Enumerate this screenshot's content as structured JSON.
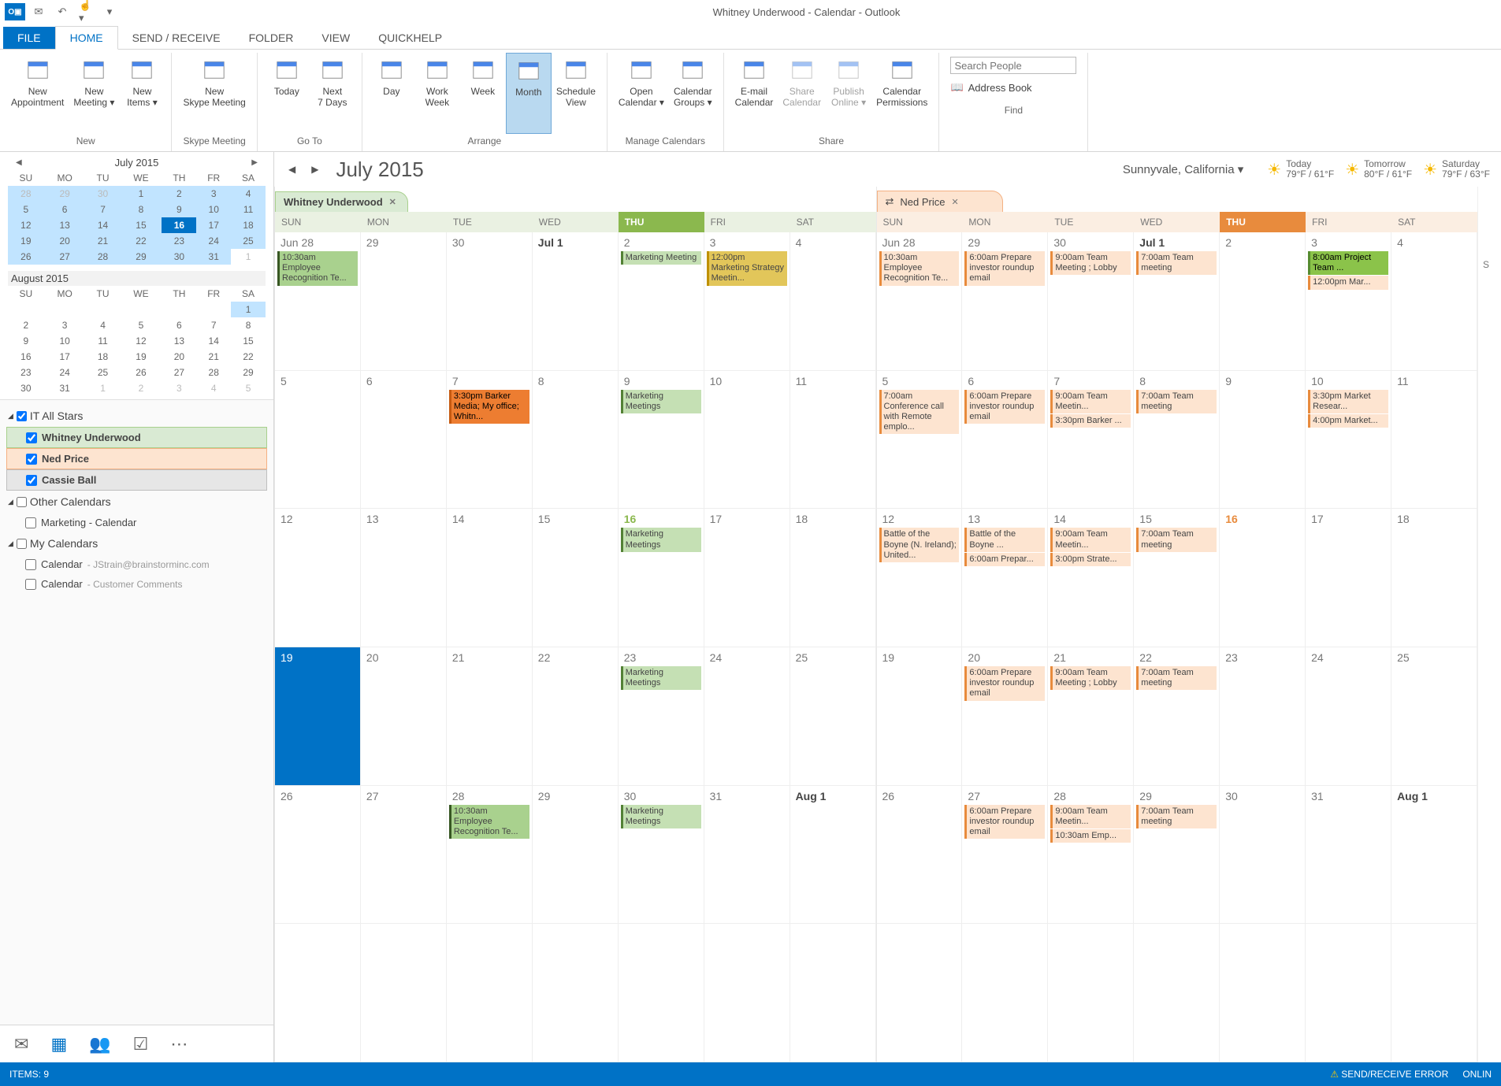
{
  "titlebar": {
    "title": "Whitney Underwood - Calendar - Outlook"
  },
  "tabs": [
    "FILE",
    "HOME",
    "SEND / RECEIVE",
    "FOLDER",
    "VIEW",
    "QUICKHELP"
  ],
  "ribbon": {
    "groups": {
      "new": {
        "label": "New",
        "btns": [
          "New Appointment",
          "New Meeting ▾",
          "New Items ▾"
        ]
      },
      "skype": {
        "label": "Skype Meeting",
        "btns": [
          "New Skype Meeting"
        ]
      },
      "goto": {
        "label": "Go To",
        "btns": [
          "Today",
          "Next 7 Days"
        ]
      },
      "arrange": {
        "label": "Arrange",
        "btns": [
          "Day",
          "Work Week",
          "Week",
          "Month",
          "Schedule View"
        ]
      },
      "manage": {
        "label": "Manage Calendars",
        "btns": [
          "Open Calendar ▾",
          "Calendar Groups ▾"
        ]
      },
      "share": {
        "label": "Share",
        "btns": [
          "E-mail Calendar",
          "Share Calendar",
          "Publish Online ▾",
          "Calendar Permissions"
        ]
      },
      "find": {
        "label": "Find",
        "search_placeholder": "Search People",
        "ab": "Address Book"
      }
    }
  },
  "minicals": [
    {
      "month": "July 2015",
      "dows": [
        "SU",
        "MO",
        "TU",
        "WE",
        "TH",
        "FR",
        "SA"
      ],
      "rows": [
        [
          {
            "d": 28,
            "dim": true,
            "hl": true
          },
          {
            "d": 29,
            "dim": true,
            "hl": true
          },
          {
            "d": 30,
            "dim": true,
            "hl": true
          },
          {
            "d": 1,
            "hl": true
          },
          {
            "d": 2,
            "hl": true
          },
          {
            "d": 3,
            "hl": true
          },
          {
            "d": 4,
            "hl": true
          }
        ],
        [
          {
            "d": 5,
            "hl": true
          },
          {
            "d": 6,
            "hl": true
          },
          {
            "d": 7,
            "hl": true
          },
          {
            "d": 8,
            "hl": true
          },
          {
            "d": 9,
            "hl": true
          },
          {
            "d": 10,
            "hl": true
          },
          {
            "d": 11,
            "hl": true
          }
        ],
        [
          {
            "d": 12,
            "hl": true
          },
          {
            "d": 13,
            "hl": true
          },
          {
            "d": 14,
            "hl": true
          },
          {
            "d": 15,
            "hl": true
          },
          {
            "d": 16,
            "today": true
          },
          {
            "d": 17,
            "hl": true
          },
          {
            "d": 18,
            "hl": true
          }
        ],
        [
          {
            "d": 19,
            "hl": true
          },
          {
            "d": 20,
            "hl": true
          },
          {
            "d": 21,
            "hl": true
          },
          {
            "d": 22,
            "hl": true
          },
          {
            "d": 23,
            "hl": true
          },
          {
            "d": 24,
            "hl": true
          },
          {
            "d": 25,
            "hl": true
          }
        ],
        [
          {
            "d": 26,
            "hl": true
          },
          {
            "d": 27,
            "hl": true
          },
          {
            "d": 28,
            "hl": true
          },
          {
            "d": 29,
            "hl": true
          },
          {
            "d": 30,
            "hl": true
          },
          {
            "d": 31,
            "hl": true
          },
          {
            "d": 1,
            "dim": true
          }
        ]
      ]
    },
    {
      "month": "August 2015",
      "dows": [
        "SU",
        "MO",
        "TU",
        "WE",
        "TH",
        "FR",
        "SA"
      ],
      "rows": [
        [
          {
            "d": ""
          },
          {
            "d": ""
          },
          {
            "d": ""
          },
          {
            "d": ""
          },
          {
            "d": ""
          },
          {
            "d": ""
          },
          {
            "d": 1,
            "hl": true
          }
        ],
        [
          {
            "d": 2
          },
          {
            "d": 3
          },
          {
            "d": 4
          },
          {
            "d": 5
          },
          {
            "d": 6
          },
          {
            "d": 7
          },
          {
            "d": 8
          }
        ],
        [
          {
            "d": 9
          },
          {
            "d": 10
          },
          {
            "d": 11
          },
          {
            "d": 12
          },
          {
            "d": 13
          },
          {
            "d": 14
          },
          {
            "d": 15
          }
        ],
        [
          {
            "d": 16
          },
          {
            "d": 17
          },
          {
            "d": 18
          },
          {
            "d": 19
          },
          {
            "d": 20
          },
          {
            "d": 21
          },
          {
            "d": 22
          }
        ],
        [
          {
            "d": 23
          },
          {
            "d": 24
          },
          {
            "d": 25
          },
          {
            "d": 26
          },
          {
            "d": 27
          },
          {
            "d": 28
          },
          {
            "d": 29
          }
        ],
        [
          {
            "d": 30
          },
          {
            "d": 31
          },
          {
            "d": 1,
            "dim": true
          },
          {
            "d": 2,
            "dim": true
          },
          {
            "d": 3,
            "dim": true
          },
          {
            "d": 4,
            "dim": true
          },
          {
            "d": 5,
            "dim": true
          }
        ]
      ]
    }
  ],
  "calgroups": [
    {
      "name": "IT All Stars",
      "checked": true,
      "items": [
        {
          "name": "Whitney Underwood",
          "checked": true,
          "cls": "sel-w"
        },
        {
          "name": "Ned Price",
          "checked": true,
          "cls": "sel-n"
        },
        {
          "name": "Cassie Ball",
          "checked": true,
          "cls": "sel-c"
        }
      ]
    },
    {
      "name": "Other Calendars",
      "checked": false,
      "items": [
        {
          "name": "Marketing - Calendar",
          "checked": false
        }
      ]
    },
    {
      "name": "My Calendars",
      "checked": false,
      "items": [
        {
          "name": "Calendar",
          "sub": "- JStrain@brainstorminc.com",
          "checked": false
        },
        {
          "name": "Calendar",
          "sub": "- Customer Comments",
          "checked": false
        }
      ]
    }
  ],
  "mainhdr": {
    "month": "July 2015",
    "location": "Sunnyvale, California ▾",
    "wx": [
      {
        "label": "Today",
        "temp": "79°F / 61°F"
      },
      {
        "label": "Tomorrow",
        "temp": "80°F / 61°F"
      },
      {
        "label": "Saturday",
        "temp": "79°F / 63°F"
      }
    ]
  },
  "dows": [
    "SUN",
    "MON",
    "TUE",
    "WED",
    "THU",
    "FRI",
    "SAT"
  ],
  "calendars": [
    {
      "tab": "Whitney Underwood",
      "cls": "w",
      "weeks": [
        [
          {
            "dn": "Jun 28",
            "ev": [
              {
                "t": "10:30am Employee Recognition Te...",
                "c": "g2"
              }
            ]
          },
          {
            "dn": "29"
          },
          {
            "dn": "30"
          },
          {
            "dn": "Jul 1",
            "bold": true
          },
          {
            "dn": "2",
            "ev": [
              {
                "t": "Marketing Meeting",
                "c": "g1"
              }
            ]
          },
          {
            "dn": "3",
            "ev": [
              {
                "t": "12:00pm Marketing Strategy Meetin...",
                "c": "ye"
              }
            ]
          },
          {
            "dn": "4"
          }
        ],
        [
          {
            "dn": "5"
          },
          {
            "dn": "6"
          },
          {
            "dn": "7",
            "ev": [
              {
                "t": "3:30pm Barker Media; My office; Whitn...",
                "c": "or"
              }
            ]
          },
          {
            "dn": "8"
          },
          {
            "dn": "9",
            "ev": [
              {
                "t": "Marketing Meetings",
                "c": "g1"
              }
            ]
          },
          {
            "dn": "10"
          },
          {
            "dn": "11"
          }
        ],
        [
          {
            "dn": "12"
          },
          {
            "dn": "13"
          },
          {
            "dn": "14"
          },
          {
            "dn": "15"
          },
          {
            "dn": "16",
            "today": true,
            "ev": [
              {
                "t": "Marketing Meetings",
                "c": "g1"
              }
            ]
          },
          {
            "dn": "17"
          },
          {
            "dn": "18"
          }
        ],
        [
          {
            "dn": "19",
            "sel": true
          },
          {
            "dn": "20"
          },
          {
            "dn": "21"
          },
          {
            "dn": "22"
          },
          {
            "dn": "23",
            "ev": [
              {
                "t": "Marketing Meetings",
                "c": "g1"
              }
            ]
          },
          {
            "dn": "24"
          },
          {
            "dn": "25"
          }
        ],
        [
          {
            "dn": "26"
          },
          {
            "dn": "27"
          },
          {
            "dn": "28",
            "ev": [
              {
                "t": "10:30am Employee Recognition Te...",
                "c": "g2"
              }
            ]
          },
          {
            "dn": "29"
          },
          {
            "dn": "30",
            "ev": [
              {
                "t": "Marketing Meetings",
                "c": "g1"
              }
            ]
          },
          {
            "dn": "31"
          },
          {
            "dn": "Aug 1",
            "bold": true
          }
        ]
      ]
    },
    {
      "tab": "Ned Price",
      "cls": "n",
      "weeks": [
        [
          {
            "dn": "Jun 28",
            "ev": [
              {
                "t": "10:30am Employee Recognition Te...",
                "c": "no"
              }
            ]
          },
          {
            "dn": "29",
            "ev": [
              {
                "t": "6:00am Prepare investor roundup email",
                "c": "no"
              }
            ]
          },
          {
            "dn": "30",
            "ev": [
              {
                "t": "9:00am Team Meeting ; Lobby",
                "c": "no"
              }
            ]
          },
          {
            "dn": "Jul 1",
            "bold": true,
            "ev": [
              {
                "t": "7:00am Team meeting",
                "c": "no"
              }
            ]
          },
          {
            "dn": "2"
          },
          {
            "dn": "3",
            "ev": [
              {
                "t": "8:00am Project Team ...",
                "c": "ng"
              },
              {
                "t": "12:00pm Mar...",
                "c": "no"
              }
            ]
          },
          {
            "dn": "4"
          }
        ],
        [
          {
            "dn": "5",
            "ev": [
              {
                "t": "7:00am Conference call with Remote emplo...",
                "c": "no"
              }
            ]
          },
          {
            "dn": "6",
            "ev": [
              {
                "t": "6:00am Prepare investor roundup email",
                "c": "no"
              }
            ]
          },
          {
            "dn": "7",
            "ev": [
              {
                "t": "9:00am Team Meetin...",
                "c": "no"
              },
              {
                "t": "3:30pm Barker ...",
                "c": "no"
              }
            ]
          },
          {
            "dn": "8",
            "ev": [
              {
                "t": "7:00am Team meeting",
                "c": "no"
              }
            ]
          },
          {
            "dn": "9"
          },
          {
            "dn": "10",
            "ev": [
              {
                "t": "3:30pm Market Resear...",
                "c": "no"
              },
              {
                "t": "4:00pm Market...",
                "c": "no"
              }
            ]
          },
          {
            "dn": "11"
          }
        ],
        [
          {
            "dn": "12",
            "ev": [
              {
                "t": "Battle of the Boyne (N. Ireland); United...",
                "c": "no"
              }
            ]
          },
          {
            "dn": "13",
            "ev": [
              {
                "t": "Battle of the Boyne ...",
                "c": "no"
              },
              {
                "t": "6:00am Prepar...",
                "c": "no"
              }
            ]
          },
          {
            "dn": "14",
            "ev": [
              {
                "t": "9:00am Team Meetin...",
                "c": "no"
              },
              {
                "t": "3:00pm Strate...",
                "c": "no"
              }
            ]
          },
          {
            "dn": "15",
            "ev": [
              {
                "t": "7:00am Team meeting",
                "c": "no"
              }
            ]
          },
          {
            "dn": "16",
            "today": true
          },
          {
            "dn": "17"
          },
          {
            "dn": "18"
          }
        ],
        [
          {
            "dn": "19"
          },
          {
            "dn": "20",
            "ev": [
              {
                "t": "6:00am Prepare investor roundup email",
                "c": "no"
              }
            ]
          },
          {
            "dn": "21",
            "ev": [
              {
                "t": "9:00am Team Meeting ; Lobby",
                "c": "no"
              }
            ]
          },
          {
            "dn": "22",
            "ev": [
              {
                "t": "7:00am Team meeting",
                "c": "no"
              }
            ]
          },
          {
            "dn": "23"
          },
          {
            "dn": "24"
          },
          {
            "dn": "25"
          }
        ],
        [
          {
            "dn": "26"
          },
          {
            "dn": "27",
            "ev": [
              {
                "t": "6:00am Prepare investor roundup email",
                "c": "no"
              }
            ]
          },
          {
            "dn": "28",
            "ev": [
              {
                "t": "9:00am Team Meetin...",
                "c": "no"
              },
              {
                "t": "10:30am Emp...",
                "c": "no"
              }
            ]
          },
          {
            "dn": "29",
            "ev": [
              {
                "t": "7:00am Team meeting",
                "c": "no"
              }
            ]
          },
          {
            "dn": "30"
          },
          {
            "dn": "31"
          },
          {
            "dn": "Aug 1",
            "bold": true
          }
        ]
      ]
    }
  ],
  "status": {
    "items": "ITEMS: 9",
    "err": "SEND/RECEIVE ERROR",
    "online": "ONLIN"
  }
}
